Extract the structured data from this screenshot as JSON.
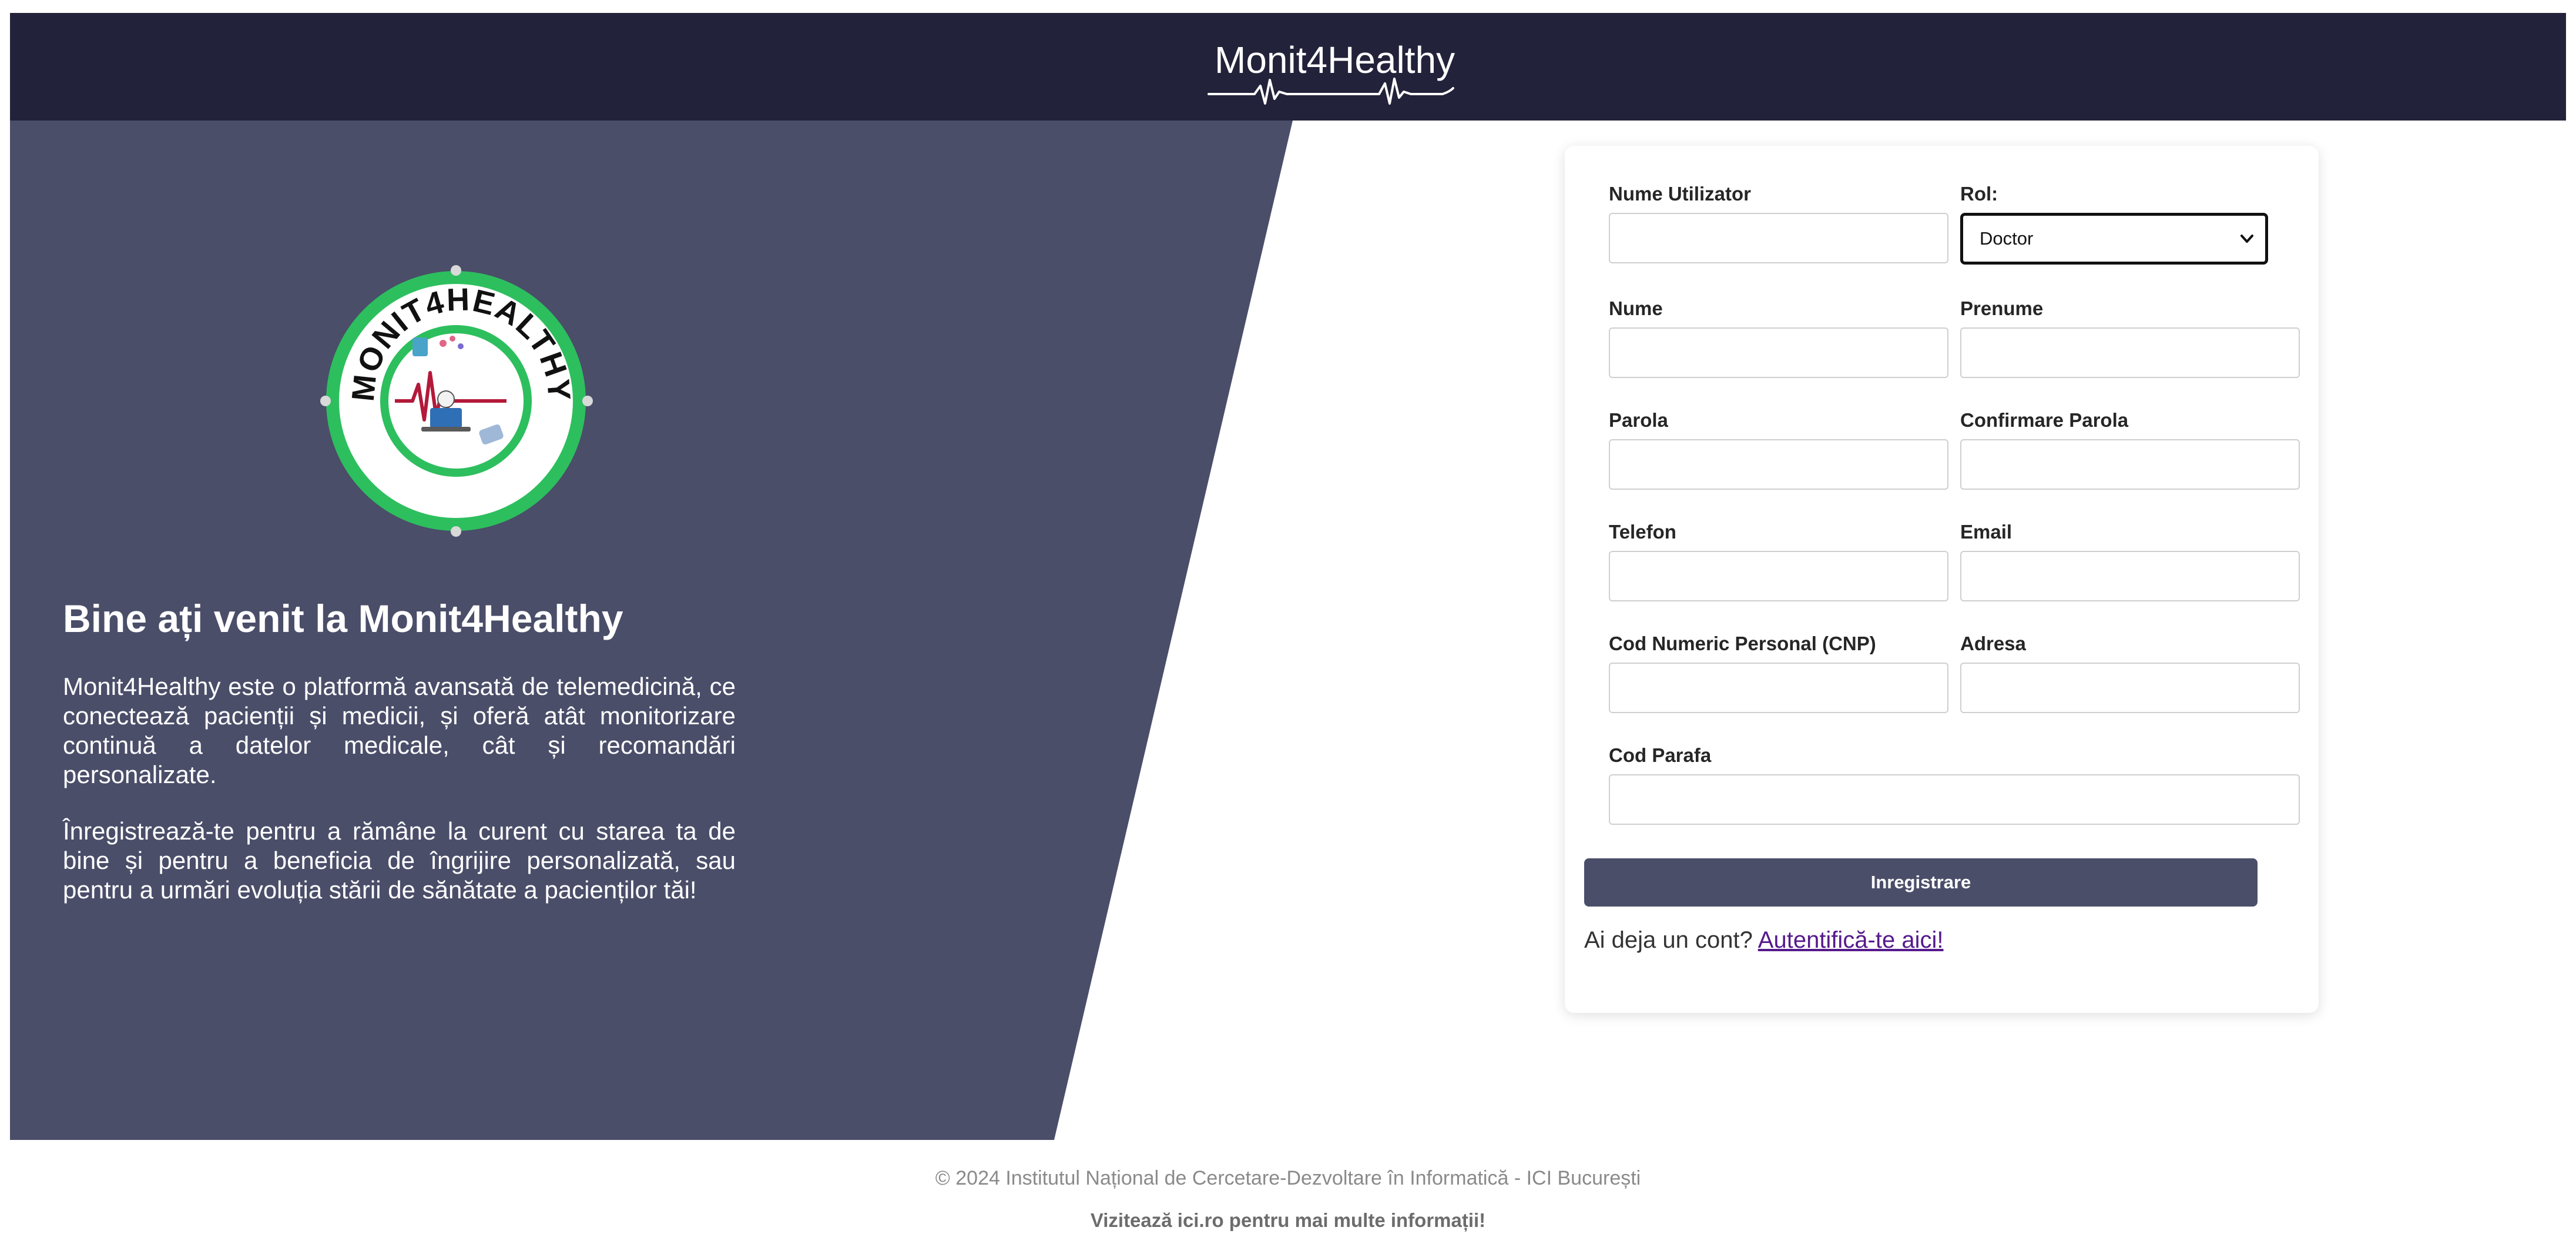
{
  "header": {
    "brand": "Monit4Healthy"
  },
  "intro": {
    "logo_text": "MONIT4HEALTHY",
    "title": "Bine ați venit la Monit4Healthy",
    "paragraph_1": "Monit4Healthy este o platformă avansată de telemedicină, ce conectează pacienții și medicii, și oferă atât monitorizare continuă a datelor medicale, cât și recomandări personalizate.",
    "paragraph_2": "Înregistrează-te pentru a rămâne la curent cu starea ta de bine și pentru a beneficia de îngrijire personalizată, sau pentru a urmări evoluția stării de sănătate a pacienților tăi!"
  },
  "form": {
    "username_label": "Nume Utilizator",
    "username_value": "",
    "role_label": "Rol:",
    "role_value": "Doctor",
    "lastname_label": "Nume",
    "lastname_value": "",
    "firstname_label": "Prenume",
    "firstname_value": "",
    "password_label": "Parola",
    "password_value": "",
    "confirm_password_label": "Confirmare Parola",
    "confirm_password_value": "",
    "phone_label": "Telefon",
    "phone_value": "",
    "email_label": "Email",
    "email_value": "",
    "cnp_label": "Cod Numeric Personal (CNP)",
    "cnp_value": "",
    "address_label": "Adresa",
    "address_value": "",
    "parafa_label": "Cod Parafa",
    "parafa_value": "",
    "register_button": "Inregistrare",
    "login_prompt": "Ai deja un cont?",
    "login_link": "Autentifică-te aici!"
  },
  "footer": {
    "copyright": "© 2024 Institutul Național de Cercetare-Dezvoltare în Informatică - ICI București",
    "visit": "Vizitează ici.ro pentru mai multe informații!"
  },
  "colors": {
    "header_bg": "#22223a",
    "panel_bg": "#4a4e69",
    "button_bg": "#4a4e69",
    "logo_ring": "#2dbf5e",
    "link": "#551a8b"
  },
  "icons": {
    "select_arrow": "chevron-down-icon",
    "logo": "monit4healthy-logo",
    "brand_wave": "heartbeat-wave-icon"
  }
}
